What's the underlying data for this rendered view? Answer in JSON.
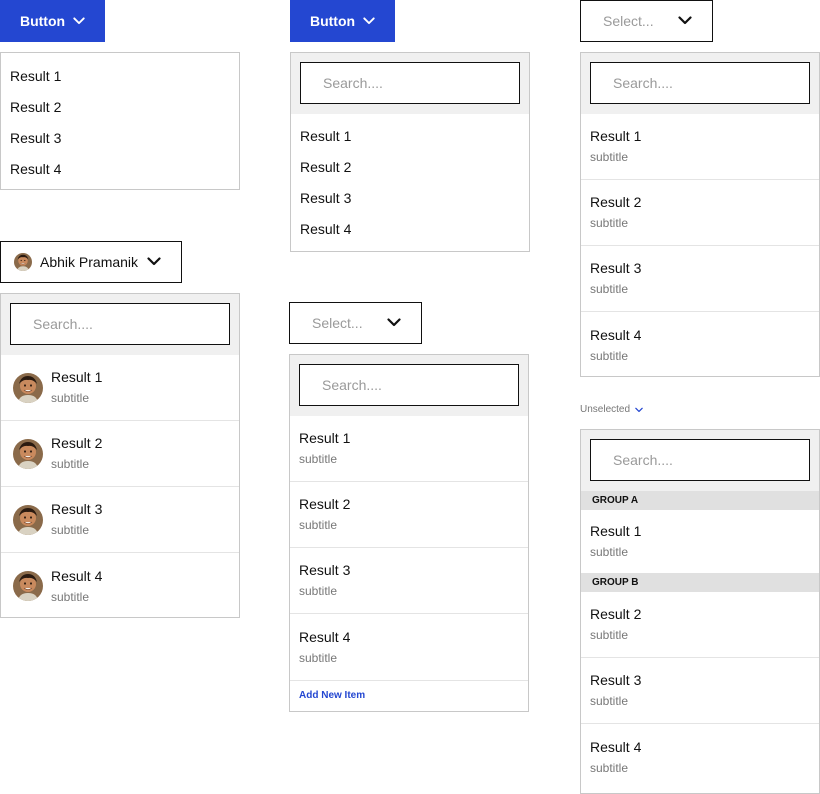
{
  "colors": {
    "accent": "#2447d1",
    "border": "#c8c8c8",
    "search_band": "#f0f0f0",
    "group_header": "#e0e0e0",
    "placeholder": "#9a9a9a",
    "subtitle": "#777777"
  },
  "icons": {
    "chevron": "chevron-down-icon",
    "avatar": "avatar-portrait"
  },
  "dropdown1": {
    "button_label": "Button",
    "items": [
      "Result 1",
      "Result 2",
      "Result 3",
      "Result 4"
    ]
  },
  "dropdown2": {
    "button_label": "Button",
    "search_placeholder": "Search....",
    "items": [
      "Result 1",
      "Result 2",
      "Result 3",
      "Result 4"
    ]
  },
  "dropdown3": {
    "select_placeholder": "Select...",
    "search_placeholder": "Search....",
    "items": [
      {
        "title": "Result 1",
        "subtitle": "subtitle"
      },
      {
        "title": "Result 2",
        "subtitle": "subtitle"
      },
      {
        "title": "Result 3",
        "subtitle": "subtitle"
      },
      {
        "title": "Result 4",
        "subtitle": "subtitle"
      }
    ]
  },
  "dropdown4": {
    "user_name": "Abhik Pramanik",
    "search_placeholder": "Search....",
    "items": [
      {
        "title": "Result 1",
        "subtitle": "subtitle"
      },
      {
        "title": "Result 2",
        "subtitle": "subtitle"
      },
      {
        "title": "Result 3",
        "subtitle": "subtitle"
      },
      {
        "title": "Result 4",
        "subtitle": "subtitle"
      }
    ]
  },
  "dropdown5": {
    "select_placeholder": "Select...",
    "search_placeholder": "Search....",
    "items": [
      {
        "title": "Result 1",
        "subtitle": "subtitle"
      },
      {
        "title": "Result 2",
        "subtitle": "subtitle"
      },
      {
        "title": "Result 3",
        "subtitle": "subtitle"
      },
      {
        "title": "Result 4",
        "subtitle": "subtitle"
      }
    ],
    "add_new_label": "Add New Item"
  },
  "dropdown6": {
    "trigger_label": "Unselected",
    "search_placeholder": "Search....",
    "group_a": "GROUP A",
    "group_b": "GROUP B",
    "group_a_items": [
      {
        "title": "Result 1",
        "subtitle": "subtitle"
      }
    ],
    "group_b_items": [
      {
        "title": "Result 2",
        "subtitle": "subtitle"
      },
      {
        "title": "Result 3",
        "subtitle": "subtitle"
      },
      {
        "title": "Result 4",
        "subtitle": "subtitle"
      }
    ]
  }
}
